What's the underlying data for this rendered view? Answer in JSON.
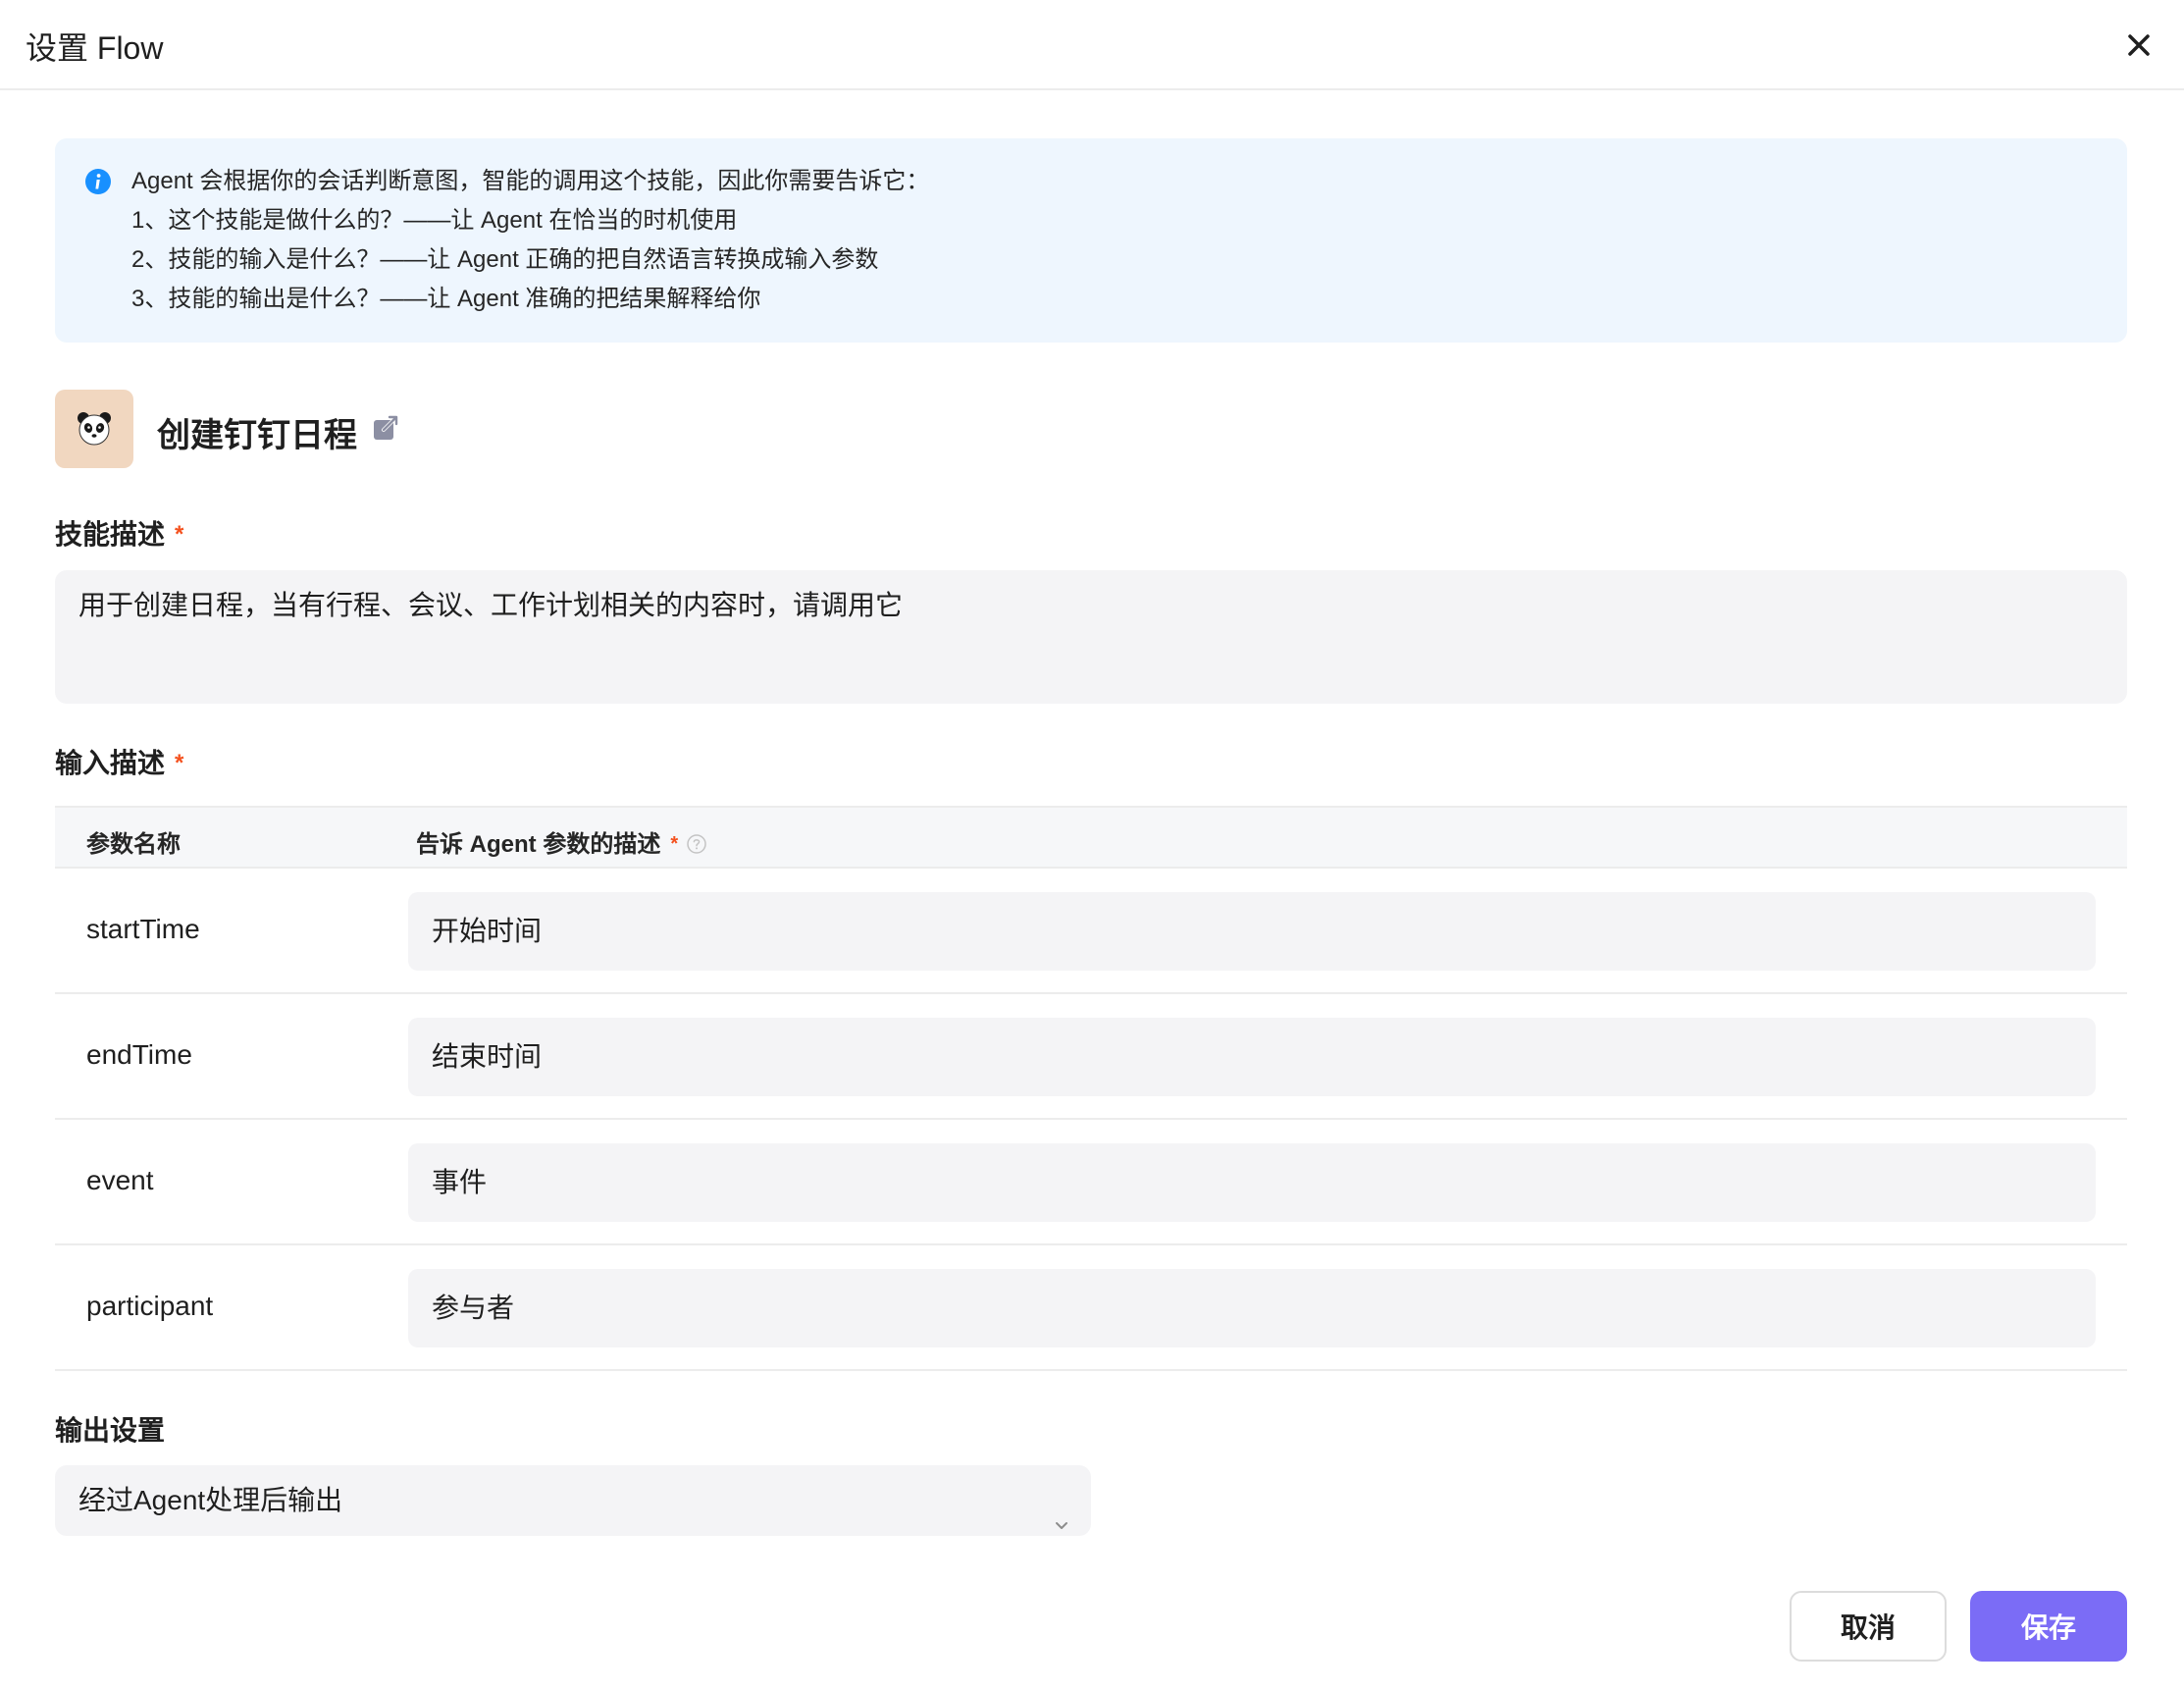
{
  "header": {
    "title": "设置 Flow",
    "close_icon": "close-icon"
  },
  "info": {
    "intro": "Agent 会根据你的会话判断意图，智能的调用这个技能，因此你需要告诉它：",
    "items": [
      "1、这个技能是做什么的？——让 Agent 在恰当的时机使用",
      "2、技能的输入是什么？——让 Agent 正确的把自然语言转换成输入参数",
      "3、技能的输出是什么？——让 Agent 准确的把结果解释给你"
    ],
    "icon": "info-icon"
  },
  "skill": {
    "name": "创建钉钉日程",
    "avatar_icon": "panda-icon",
    "link_icon": "external-link-icon"
  },
  "description": {
    "label": "技能描述",
    "required_mark": "*",
    "value": "用于创建日程，当有行程、会议、工作计划相关的内容时，请调用它"
  },
  "input": {
    "label": "输入描述",
    "required_mark": "*",
    "columns": {
      "name": "参数名称",
      "desc": "告诉 Agent 参数的描述",
      "desc_required": "*"
    },
    "rows": [
      {
        "name": "startTime",
        "desc": "开始时间"
      },
      {
        "name": "endTime",
        "desc": "结束时间"
      },
      {
        "name": "event",
        "desc": "事件"
      },
      {
        "name": "participant",
        "desc": "参与者"
      }
    ]
  },
  "output": {
    "label": "输出设置",
    "selected": "经过Agent处理后输出"
  },
  "footer": {
    "cancel": "取消",
    "save": "保存"
  },
  "colors": {
    "accent": "#7b6cf6",
    "info_bg": "#eef6fe",
    "required": "#f4511e",
    "info_icon": "#1890ff"
  }
}
